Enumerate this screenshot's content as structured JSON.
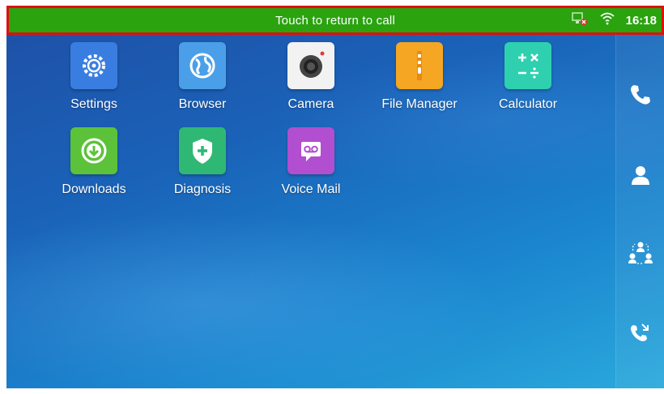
{
  "status_bar": {
    "message": "Touch to return to call",
    "time": "16:18",
    "icons": [
      "network-disconnected-icon",
      "wifi-icon"
    ],
    "background_color": "#2aa30f",
    "highlight_border_color": "#e01010"
  },
  "apps": [
    {
      "label": "Settings",
      "icon": "settings-icon",
      "color": "#3a7de0"
    },
    {
      "label": "Browser",
      "icon": "globe-icon",
      "color": "#4a9fe8"
    },
    {
      "label": "Camera",
      "icon": "camera-icon",
      "color": "#f2f2f2"
    },
    {
      "label": "File Manager",
      "icon": "folder-icon",
      "color": "#f5a623"
    },
    {
      "label": "Calculator",
      "icon": "calculator-icon",
      "color": "#2fd0b0"
    },
    {
      "label": "Downloads",
      "icon": "download-icon",
      "color": "#5cc23a"
    },
    {
      "label": "Diagnosis",
      "icon": "shield-plus-icon",
      "color": "#2fb874"
    },
    {
      "label": "Voice Mail",
      "icon": "voicemail-icon",
      "color": "#b14fd0"
    }
  ],
  "dock": [
    "phone-icon",
    "contact-icon",
    "conference-icon",
    "call-history-icon"
  ]
}
